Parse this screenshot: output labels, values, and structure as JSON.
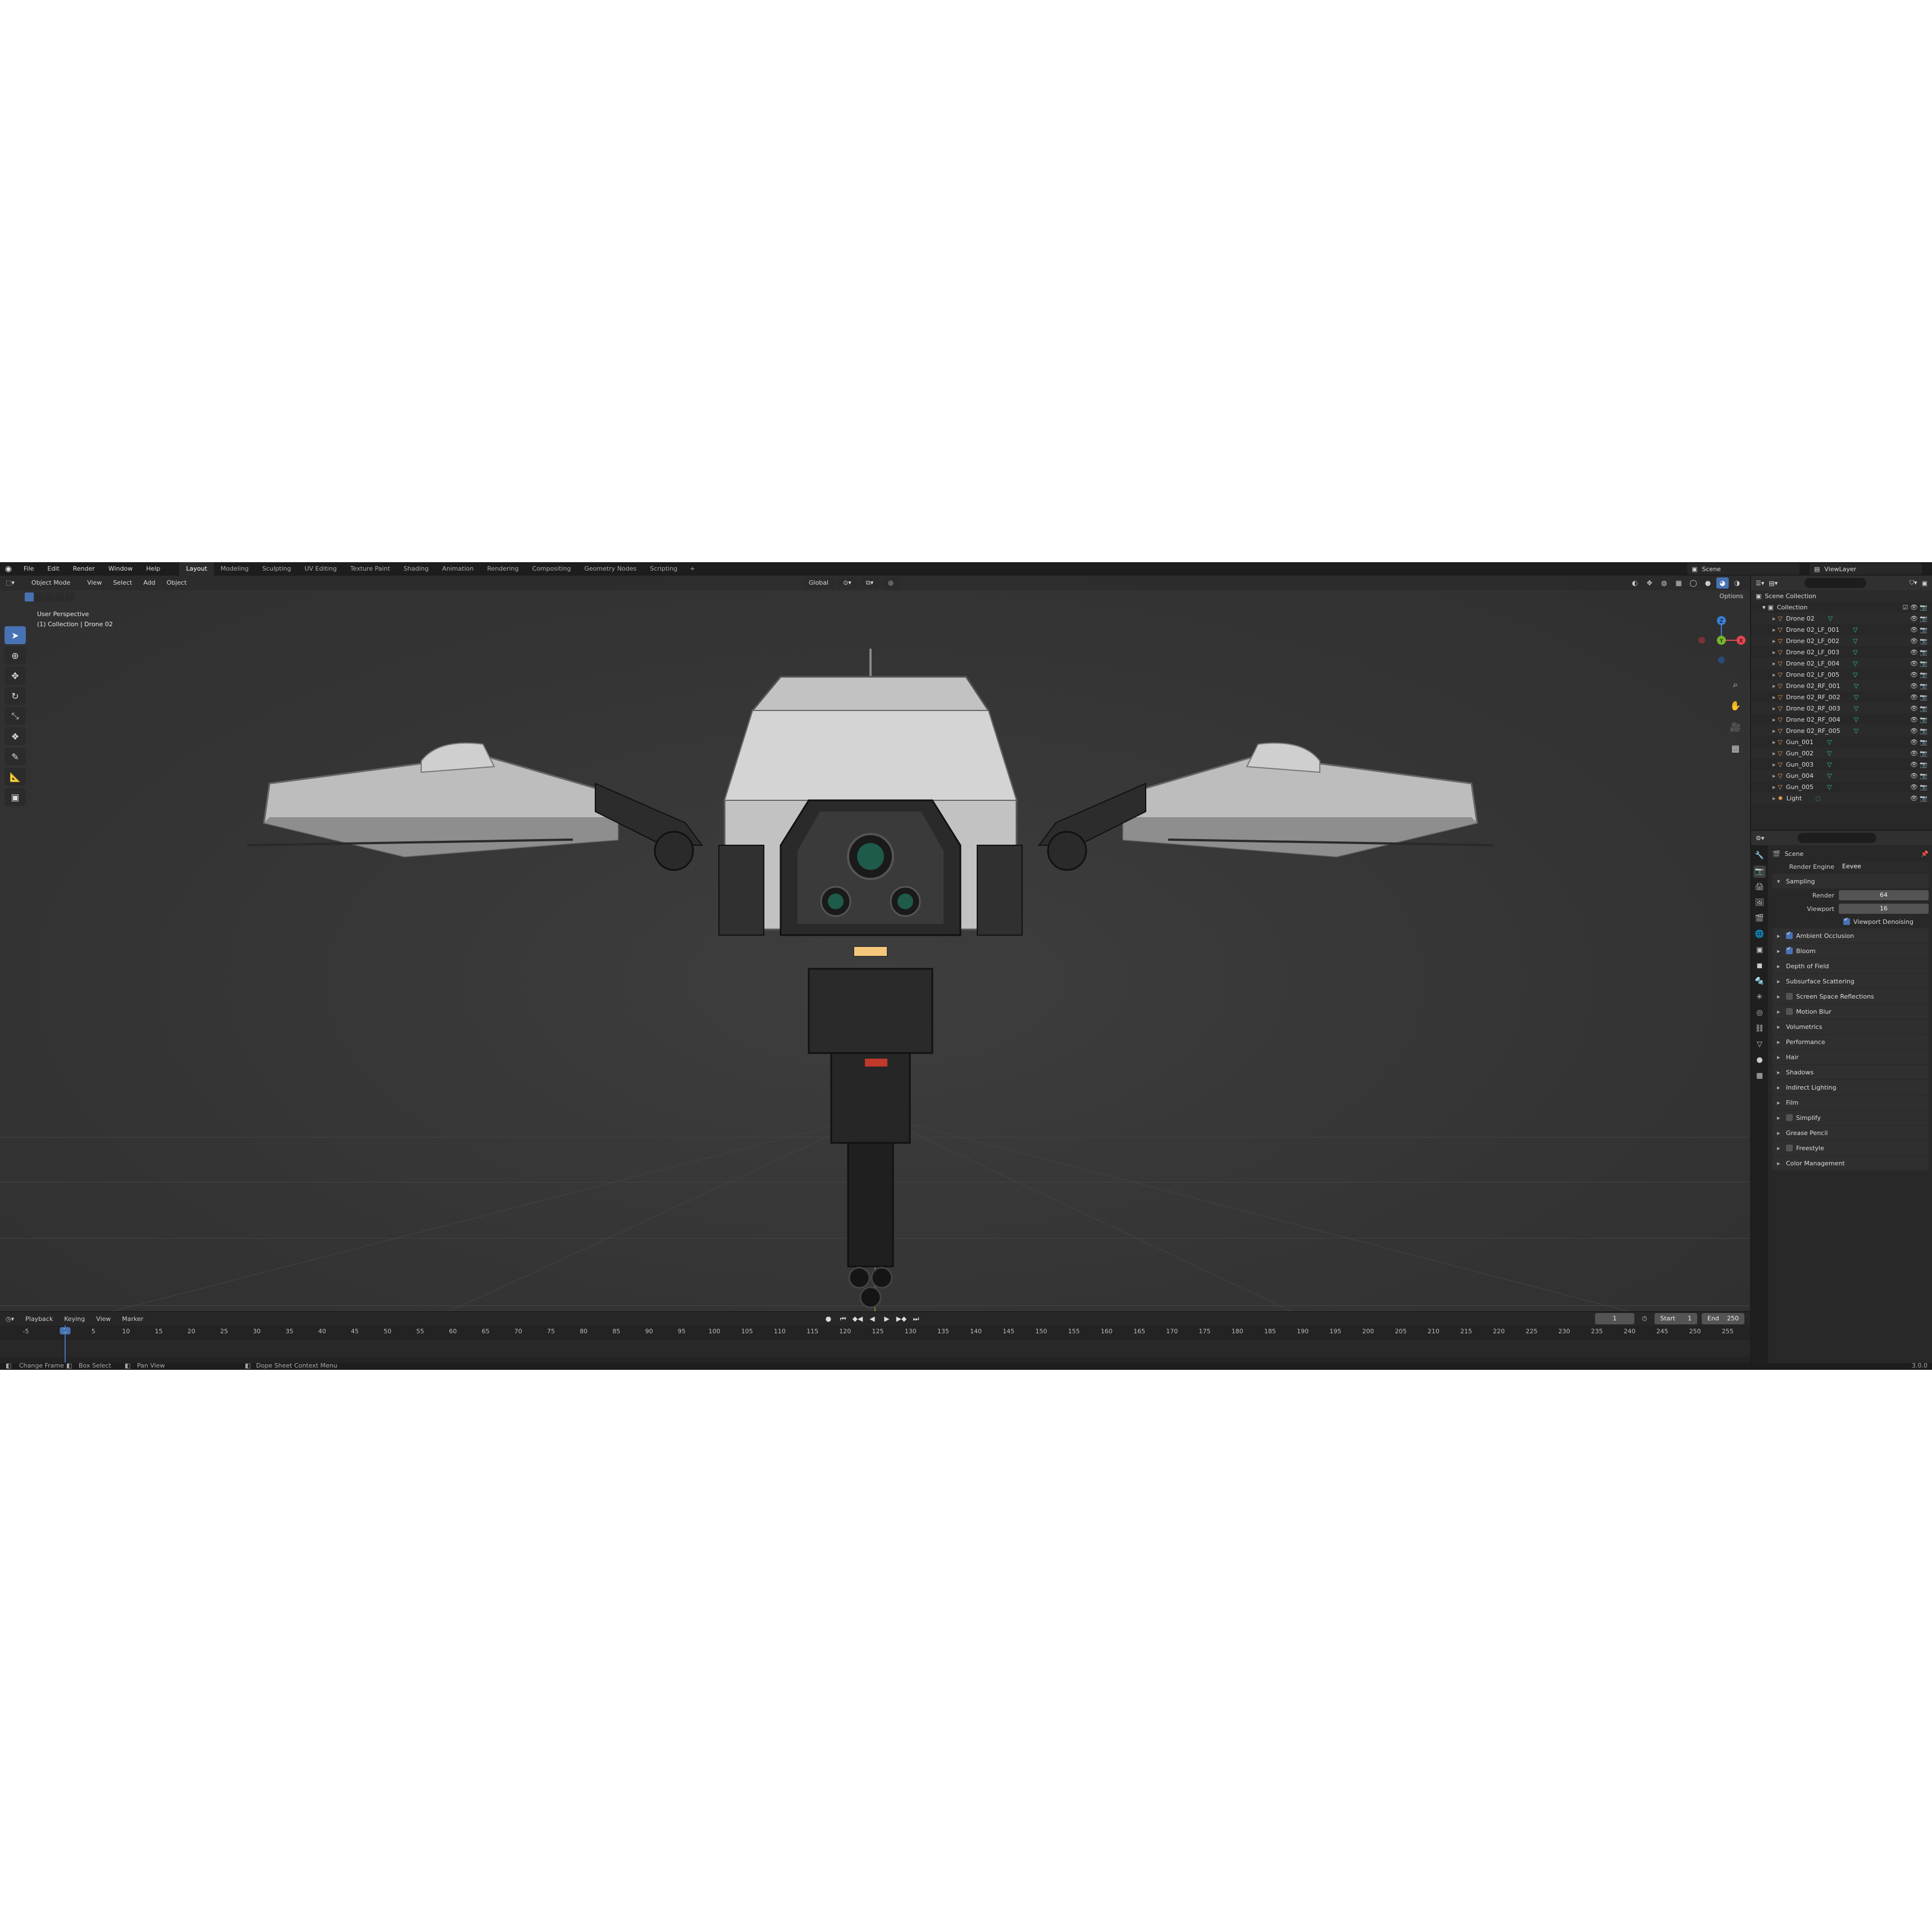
{
  "topbar": {
    "menus": [
      "File",
      "Edit",
      "Render",
      "Window",
      "Help"
    ],
    "workspaces": [
      "Layout",
      "Modeling",
      "Sculpting",
      "UV Editing",
      "Texture Paint",
      "Shading",
      "Animation",
      "Rendering",
      "Compositing",
      "Geometry Nodes",
      "Scripting"
    ],
    "active_workspace": "Layout",
    "add_tab": "+",
    "scene": "Scene",
    "view_layer": "ViewLayer"
  },
  "viewport_header": {
    "mode": "Object Mode",
    "menus": [
      "View",
      "Select",
      "Add",
      "Object"
    ],
    "orientation": "Global",
    "options": "Options"
  },
  "viewport": {
    "perspective_label": "User Perspective",
    "collection_label": "(1) Collection | Drone 02"
  },
  "gizmo": {
    "x": "X",
    "y": "Y",
    "z": "Z",
    "x_color": "#e6474f",
    "y_color": "#78b52f",
    "z_color": "#3b7fd4"
  },
  "tools": [
    "select-box",
    "cursor",
    "move",
    "rotate",
    "scale",
    "transform",
    "annotate",
    "measure",
    "add-cube"
  ],
  "timeline": {
    "menus": [
      "Playback",
      "Keying",
      "View",
      "Marker"
    ],
    "current_frame": "1",
    "start_label": "Start",
    "start": "1",
    "end_label": "End",
    "end": "250",
    "ticks": [
      "-5",
      "1",
      "5",
      "10",
      "15",
      "20",
      "25",
      "30",
      "35",
      "40",
      "45",
      "50",
      "55",
      "60",
      "65",
      "70",
      "75",
      "80",
      "85",
      "90",
      "95",
      "100",
      "105",
      "110",
      "115",
      "120",
      "125",
      "130",
      "135",
      "140",
      "145",
      "150",
      "155",
      "160",
      "165",
      "170",
      "175",
      "180",
      "185",
      "190",
      "195",
      "200",
      "205",
      "210",
      "215",
      "220",
      "225",
      "230",
      "235",
      "240",
      "245",
      "250",
      "255"
    ]
  },
  "statusbar": {
    "items": [
      "Change Frame",
      "Box Select",
      "Pan View",
      "Dope Sheet Context Menu"
    ],
    "version": "3.0.0"
  },
  "outliner": {
    "scene_collection": "Scene Collection",
    "collection": "Collection",
    "objects": [
      "Drone 02",
      "Drone 02_LF_001",
      "Drone 02_LF_002",
      "Drone 02_LF_003",
      "Drone 02_LF_004",
      "Drone 02_LF_005",
      "Drone 02_RF_001",
      "Drone 02_RF_002",
      "Drone 02_RF_003",
      "Drone 02_RF_004",
      "Drone 02_RF_005",
      "Gun_001",
      "Gun_002",
      "Gun_003",
      "Gun_004",
      "Gun_005",
      "Light"
    ]
  },
  "properties": {
    "scene": "Scene",
    "render_engine_label": "Render Engine",
    "render_engine": "Eevee",
    "sampling": "Sampling",
    "render_label": "Render",
    "render_samples": "64",
    "viewport_label": "Viewport",
    "viewport_samples": "16",
    "viewport_denoising": "Viewport Denoising",
    "panels": [
      {
        "label": "Ambient Occlusion",
        "checkbox": true,
        "checked": true
      },
      {
        "label": "Bloom",
        "checkbox": true,
        "checked": true
      },
      {
        "label": "Depth of Field",
        "checkbox": false
      },
      {
        "label": "Subsurface Scattering",
        "checkbox": false
      },
      {
        "label": "Screen Space Reflections",
        "checkbox": true,
        "checked": false
      },
      {
        "label": "Motion Blur",
        "checkbox": true,
        "checked": false
      },
      {
        "label": "Volumetrics",
        "checkbox": false
      },
      {
        "label": "Performance",
        "checkbox": false
      },
      {
        "label": "Hair",
        "checkbox": false
      },
      {
        "label": "Shadows",
        "checkbox": false
      },
      {
        "label": "Indirect Lighting",
        "checkbox": false
      },
      {
        "label": "Film",
        "checkbox": false
      },
      {
        "label": "Simplify",
        "checkbox": true,
        "checked": false
      },
      {
        "label": "Grease Pencil",
        "checkbox": false
      },
      {
        "label": "Freestyle",
        "checkbox": true,
        "checked": false
      },
      {
        "label": "Color Management",
        "checkbox": false
      }
    ]
  },
  "colors": {
    "accent": "#4772b3",
    "bg": "#1d1d1d",
    "panel": "#282828",
    "object_orange": "#e89a4e",
    "mesh_green": "#33c4a3"
  }
}
